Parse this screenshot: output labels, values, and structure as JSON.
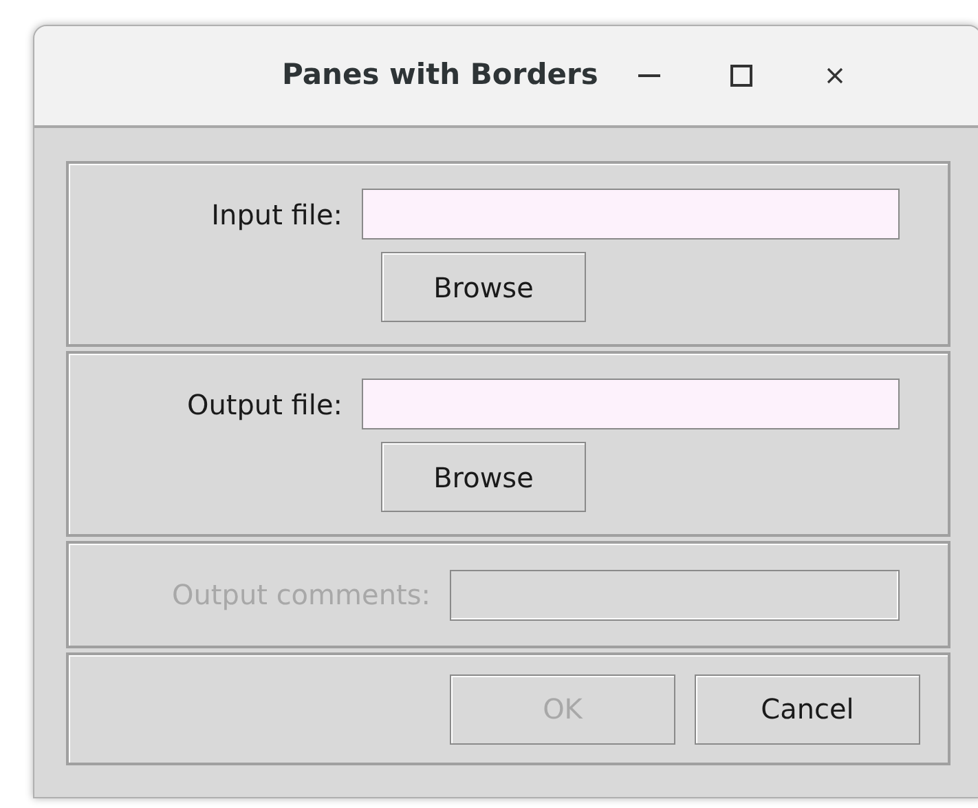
{
  "window": {
    "title": "Panes with Borders"
  },
  "panes": [
    {
      "kind": "file",
      "label": "Input file:",
      "button": "Browse",
      "disabled": false
    },
    {
      "kind": "file",
      "label": "Output file:",
      "button": "Browse",
      "disabled": false
    },
    {
      "kind": "text",
      "label": "Output comments:",
      "disabled": true
    }
  ],
  "buttons": [
    {
      "label": "OK",
      "disabled": true
    },
    {
      "label": "Cancel",
      "disabled": false
    }
  ]
}
